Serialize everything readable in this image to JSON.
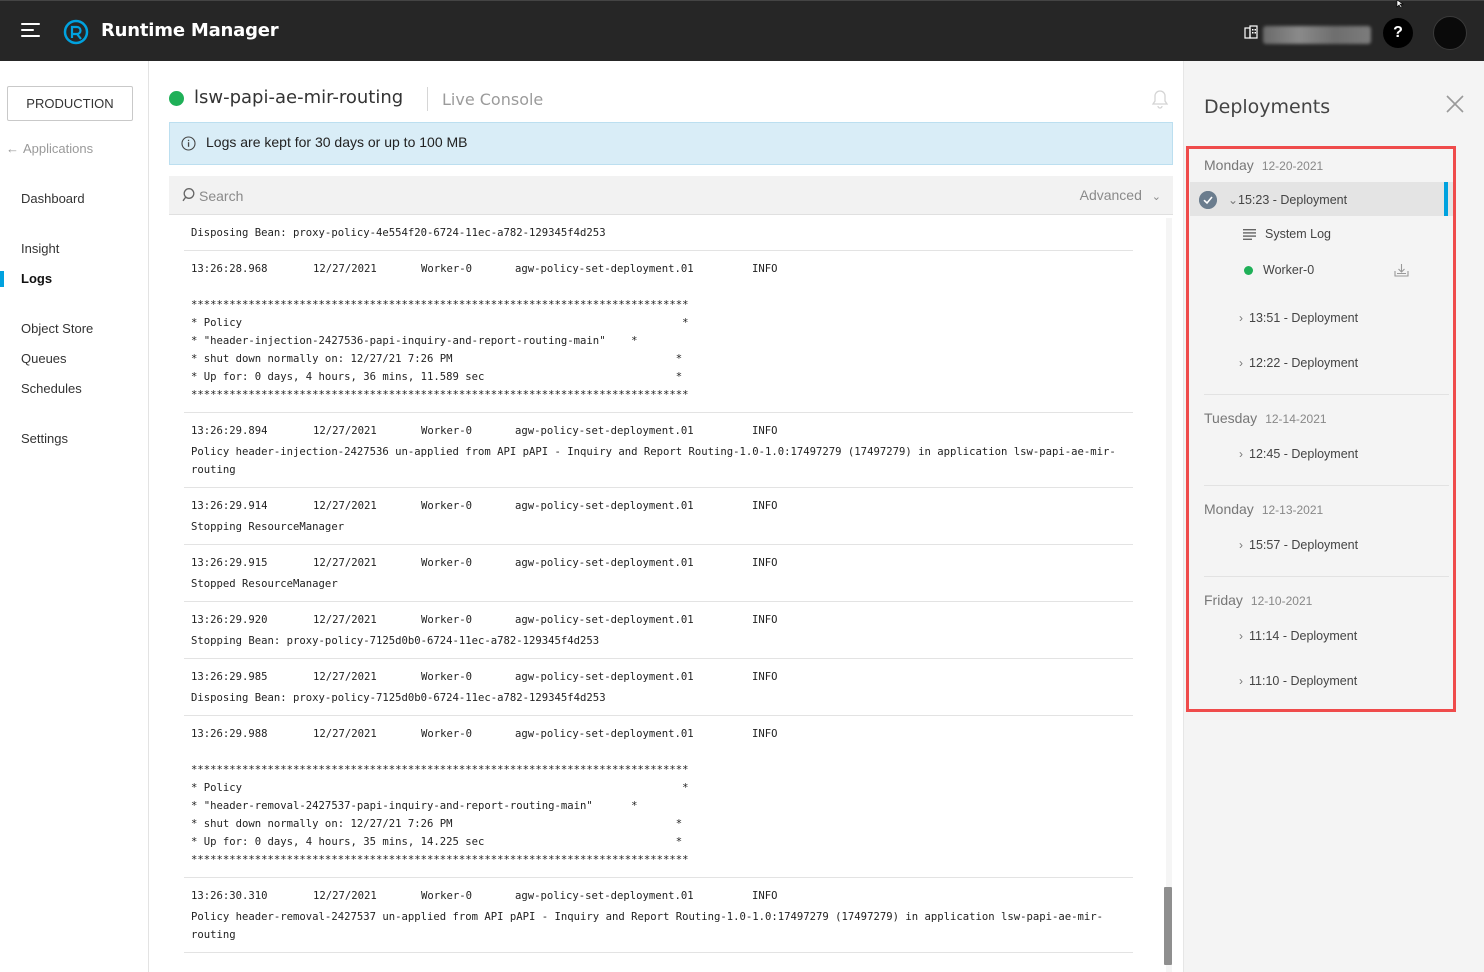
{
  "header": {
    "app_title": "Runtime Manager",
    "help_label": "?"
  },
  "leftnav": {
    "environment": "PRODUCTION",
    "back_label": "Applications",
    "items": [
      {
        "label": "Dashboard"
      },
      {
        "label": "Insight"
      },
      {
        "label": "Logs"
      },
      {
        "label": "Object Store"
      },
      {
        "label": "Queues"
      },
      {
        "label": "Schedules"
      },
      {
        "label": "Settings"
      }
    ]
  },
  "main": {
    "app_name": "lsw-papi-ae-mir-routing",
    "view_label": "Live Console",
    "info_text": "Logs are kept for 30 days or up to 100 MB",
    "search_placeholder": "Search",
    "advanced_label": "Advanced"
  },
  "logs": {
    "first_msg": "Disposing Bean: proxy-policy-4e554f20-6724-11ec-a782-129345f4d253",
    "entries": [
      {
        "time": "13:26:28.968",
        "date": "12/27/2021",
        "worker": "Worker-0",
        "category": "agw-policy-set-deployment.01",
        "level": "INFO",
        "message": "******************************************************************************\n* Policy                                                                     *\n* \"header-injection-2427536-papi-inquiry-and-report-routing-main\"    *\n* shut down normally on: 12/27/21 7:26 PM                                   *\n* Up for: 0 days, 4 hours, 36 mins, 11.589 sec                              *\n******************************************************************************"
      },
      {
        "time": "13:26:29.894",
        "date": "12/27/2021",
        "worker": "Worker-0",
        "category": "agw-policy-set-deployment.01",
        "level": "INFO",
        "message": "Policy header-injection-2427536 un-applied from API pAPI - Inquiry and Report Routing-1.0-1.0:17497279 (17497279) in application lsw-papi-ae-mir-routing"
      },
      {
        "time": "13:26:29.914",
        "date": "12/27/2021",
        "worker": "Worker-0",
        "category": "agw-policy-set-deployment.01",
        "level": "INFO",
        "message": "Stopping ResourceManager"
      },
      {
        "time": "13:26:29.915",
        "date": "12/27/2021",
        "worker": "Worker-0",
        "category": "agw-policy-set-deployment.01",
        "level": "INFO",
        "message": "Stopped ResourceManager"
      },
      {
        "time": "13:26:29.920",
        "date": "12/27/2021",
        "worker": "Worker-0",
        "category": "agw-policy-set-deployment.01",
        "level": "INFO",
        "message": "Stopping Bean: proxy-policy-7125d0b0-6724-11ec-a782-129345f4d253"
      },
      {
        "time": "13:26:29.985",
        "date": "12/27/2021",
        "worker": "Worker-0",
        "category": "agw-policy-set-deployment.01",
        "level": "INFO",
        "message": "Disposing Bean: proxy-policy-7125d0b0-6724-11ec-a782-129345f4d253"
      },
      {
        "time": "13:26:29.988",
        "date": "12/27/2021",
        "worker": "Worker-0",
        "category": "agw-policy-set-deployment.01",
        "level": "INFO",
        "message": "******************************************************************************\n* Policy                                                                     *\n* \"header-removal-2427537-papi-inquiry-and-report-routing-main\"      *\n* shut down normally on: 12/27/21 7:26 PM                                   *\n* Up for: 0 days, 4 hours, 35 mins, 14.225 sec                              *\n******************************************************************************"
      },
      {
        "time": "13:26:30.310",
        "date": "12/27/2021",
        "worker": "Worker-0",
        "category": "agw-policy-set-deployment.01",
        "level": "INFO",
        "message": "Policy header-removal-2427537 un-applied from API pAPI - Inquiry and Report Routing-1.0-1.0:17497279 (17497279) in application lsw-papi-ae-mir-routing"
      }
    ]
  },
  "deployments": {
    "title": "Deployments",
    "days": [
      {
        "day": "Monday",
        "date": "12-20-2021",
        "items": [
          "15:23 - Deployment",
          "13:51 - Deployment",
          "12:22 - Deployment"
        ]
      },
      {
        "day": "Tuesday",
        "date": "12-14-2021",
        "items": [
          "12:45 - Deployment"
        ]
      },
      {
        "day": "Monday",
        "date": "12-13-2021",
        "items": [
          "15:57 - Deployment"
        ]
      },
      {
        "day": "Friday",
        "date": "12-10-2021",
        "items": [
          "11:14 - Deployment",
          "11:10 - Deployment"
        ]
      }
    ],
    "sub_items": {
      "system_log": "System Log",
      "worker": "Worker-0"
    }
  }
}
